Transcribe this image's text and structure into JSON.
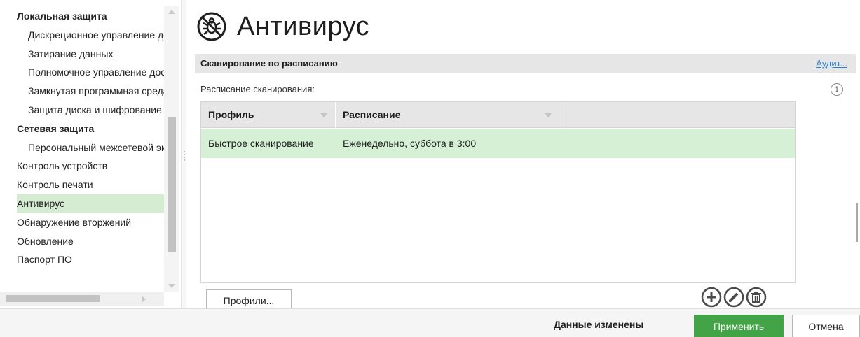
{
  "sidebar": {
    "items": [
      {
        "label": "Локальная защита",
        "kind": "group"
      },
      {
        "label": "Дискреционное управление доступом",
        "kind": "sub"
      },
      {
        "label": "Затирание данных",
        "kind": "sub"
      },
      {
        "label": "Полномочное управление доступом",
        "kind": "sub"
      },
      {
        "label": "Замкнутая программная среда",
        "kind": "sub"
      },
      {
        "label": "Защита диска и шифрование",
        "kind": "sub"
      },
      {
        "label": "Сетевая защита",
        "kind": "group"
      },
      {
        "label": "Персональный межсетевой экран",
        "kind": "sub"
      },
      {
        "label": "Контроль устройств",
        "kind": "top"
      },
      {
        "label": "Контроль печати",
        "kind": "top"
      },
      {
        "label": "Антивирус",
        "kind": "top",
        "selected": true
      },
      {
        "label": "Обнаружение вторжений",
        "kind": "top"
      },
      {
        "label": "Обновление",
        "kind": "top"
      },
      {
        "label": "Паспорт ПО",
        "kind": "top"
      }
    ]
  },
  "main": {
    "title": "Антивирус",
    "title_icon": "antivirus-bug-icon",
    "section": {
      "title": "Сканирование по расписанию",
      "audit_link": "Аудит..."
    },
    "schedule_label": "Расписание сканирования:",
    "info_icon_glyph": "i",
    "table": {
      "columns": [
        "Профиль",
        "Расписание"
      ],
      "rows": [
        {
          "profile": "Быстрое сканирование",
          "schedule": "Еженедельно, суббота в 3:00",
          "selected": true
        }
      ]
    },
    "profiles_button": "Профили...",
    "actions": [
      "add-icon",
      "edit-icon",
      "delete-icon"
    ]
  },
  "footer": {
    "status": "Данные изменены",
    "apply": "Применить",
    "cancel": "Отмена"
  },
  "colors": {
    "accent": "#43a347",
    "selection": "#d5ecd3",
    "row_selection": "#d5f0d5",
    "link": "#2e7cc6"
  }
}
